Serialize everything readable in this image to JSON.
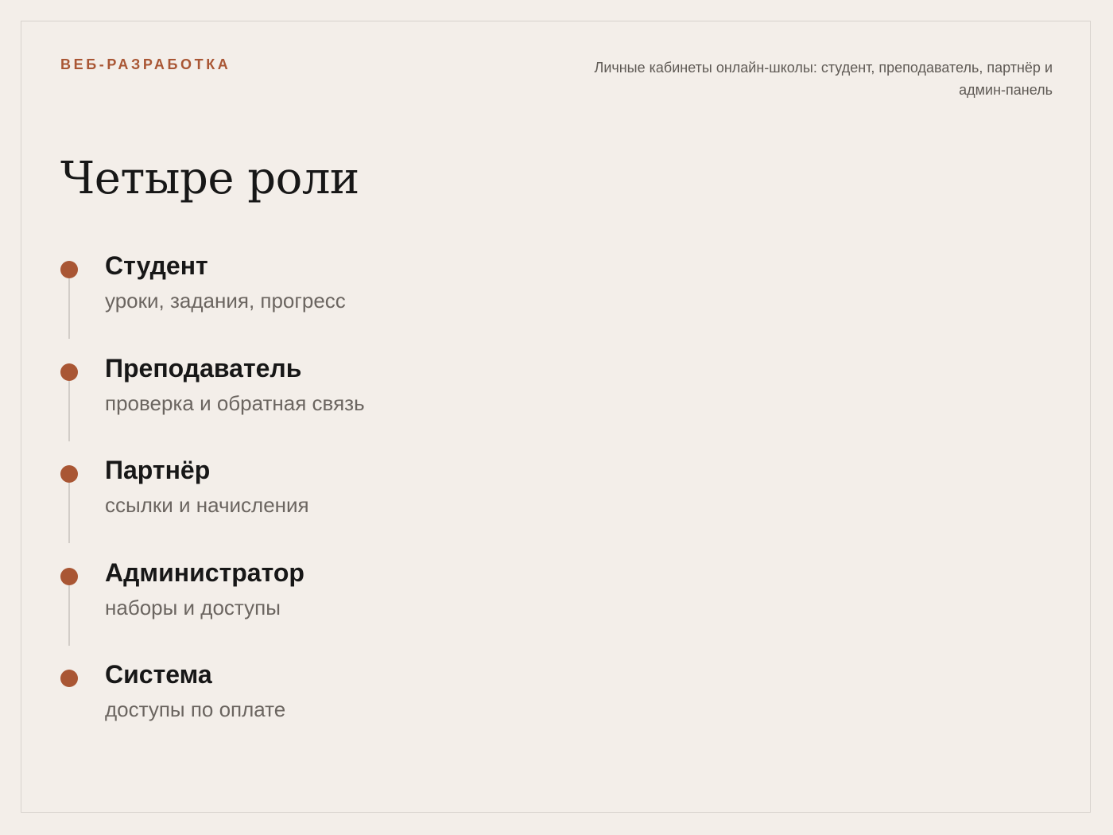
{
  "header": {
    "eyebrow": "ВЕБ-РАЗРАБОТКА",
    "subtitle": "Личные кабинеты онлайн-школы: студент, преподаватель, партнёр и админ-панель"
  },
  "title": "Четыре роли",
  "roles": [
    {
      "name": "Студент",
      "description": "уроки, задания, прогресс"
    },
    {
      "name": "Преподаватель",
      "description": "проверка и обратная связь"
    },
    {
      "name": "Партнёр",
      "description": "ссылки и начисления"
    },
    {
      "name": "Администратор",
      "description": "наборы и доступы"
    },
    {
      "name": "Система",
      "description": "доступы по оплате"
    }
  ],
  "colors": {
    "background": "#f3eee9",
    "accent": "#a95634",
    "heading": "#171717",
    "muted": "#6b6560",
    "connector": "#d2cdc8"
  }
}
